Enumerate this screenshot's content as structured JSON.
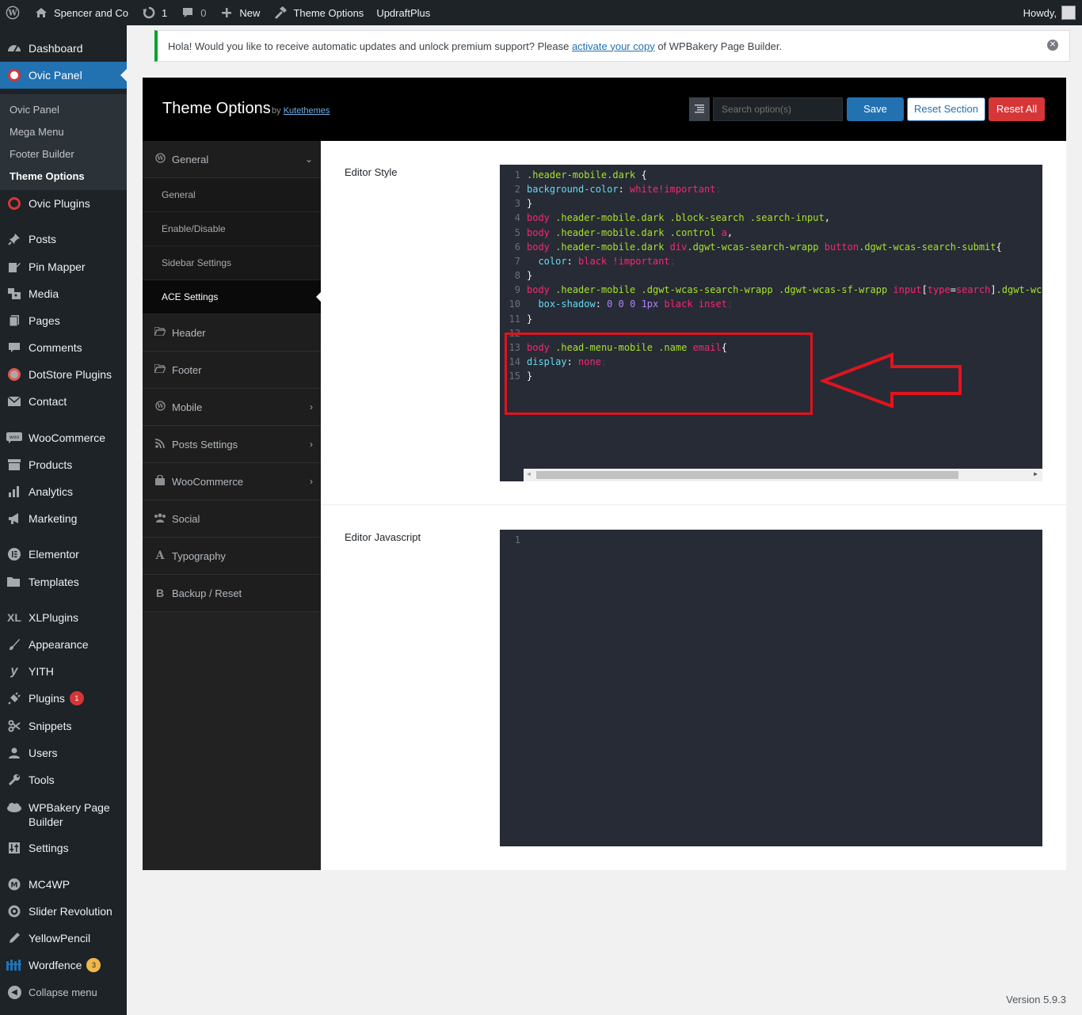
{
  "adminbar": {
    "site_name": "Spencer and Co",
    "updates_count": "1",
    "comments_count": "0",
    "new_label": "New",
    "theme_options_label": "Theme Options",
    "updraft_label": "UpdraftPlus",
    "howdy": "Howdy,"
  },
  "sidebar": {
    "dashboard": "Dashboard",
    "ovic_panel": "Ovic Panel",
    "submenu": [
      "Ovic Panel",
      "Mega Menu",
      "Footer Builder",
      "Theme Options"
    ],
    "ovic_plugins": "Ovic Plugins",
    "posts": "Posts",
    "pin_mapper": "Pin Mapper",
    "media": "Media",
    "pages": "Pages",
    "comments": "Comments",
    "dotstore": "DotStore Plugins",
    "contact": "Contact",
    "woocommerce": "WooCommerce",
    "products": "Products",
    "analytics": "Analytics",
    "marketing": "Marketing",
    "elementor": "Elementor",
    "templates": "Templates",
    "xlplugins": "XLPlugins",
    "appearance": "Appearance",
    "yith": "YITH",
    "plugins": "Plugins",
    "plugins_badge": "1",
    "snippets": "Snippets",
    "users": "Users",
    "tools": "Tools",
    "wpbakery_line1": "WPBakery Page",
    "wpbakery_line2": "Builder",
    "settings": "Settings",
    "mc4wp": "MC4WP",
    "slider_revolution": "Slider Revolution",
    "yellowpencil": "YellowPencil",
    "wordfence": "Wordfence",
    "wordfence_badge": "3",
    "collapse": "Collapse menu"
  },
  "notice": {
    "text_before": "Hola! Would you like to receive automatic updates and unlock premium support? Please ",
    "link": "activate your copy",
    "text_after": " of WPBakery Page Builder."
  },
  "options": {
    "title": "Theme Options",
    "by": "by",
    "author": "Kutethemes",
    "search_placeholder": "Search option(s)",
    "save": "Save",
    "reset_section": "Reset Section",
    "reset_all": "Reset All"
  },
  "options_nav": {
    "general": "General",
    "sub": [
      "General",
      "Enable/Disable",
      "Sidebar Settings",
      "ACE Settings"
    ],
    "header": "Header",
    "footer": "Footer",
    "mobile": "Mobile",
    "posts_settings": "Posts Settings",
    "woocommerce": "WooCommerce",
    "social": "Social",
    "typography": "Typography",
    "backup": "Backup / Reset"
  },
  "fields": {
    "editor_style": "Editor Style",
    "editor_js": "Editor Javascript"
  },
  "css_code": [
    ".header-mobile.dark {",
    "background-color: white!important;",
    "}",
    "body .header-mobile.dark .block-search .search-input,",
    "body .header-mobile.dark .control a,",
    "body .header-mobile.dark div.dgwt-wcas-search-wrapp button.dgwt-wcas-search-submit{",
    "  color: black !important;",
    "}",
    "body .header-mobile .dgwt-wcas-search-wrapp .dgwt-wcas-sf-wrapp input[type=search].dgwt-wcas",
    "  box-shadow: 0 0 0 1px black inset;",
    "}",
    "",
    "body .head-menu-mobile .name email{",
    "display: none;",
    "}"
  ],
  "js_code_line_number": "1",
  "version": "Version 5.9.3",
  "colors": {
    "admin_dark": "#1d2327",
    "accent_blue": "#2271b1",
    "danger_red": "#d63638",
    "highlight_red": "#e0141e"
  }
}
